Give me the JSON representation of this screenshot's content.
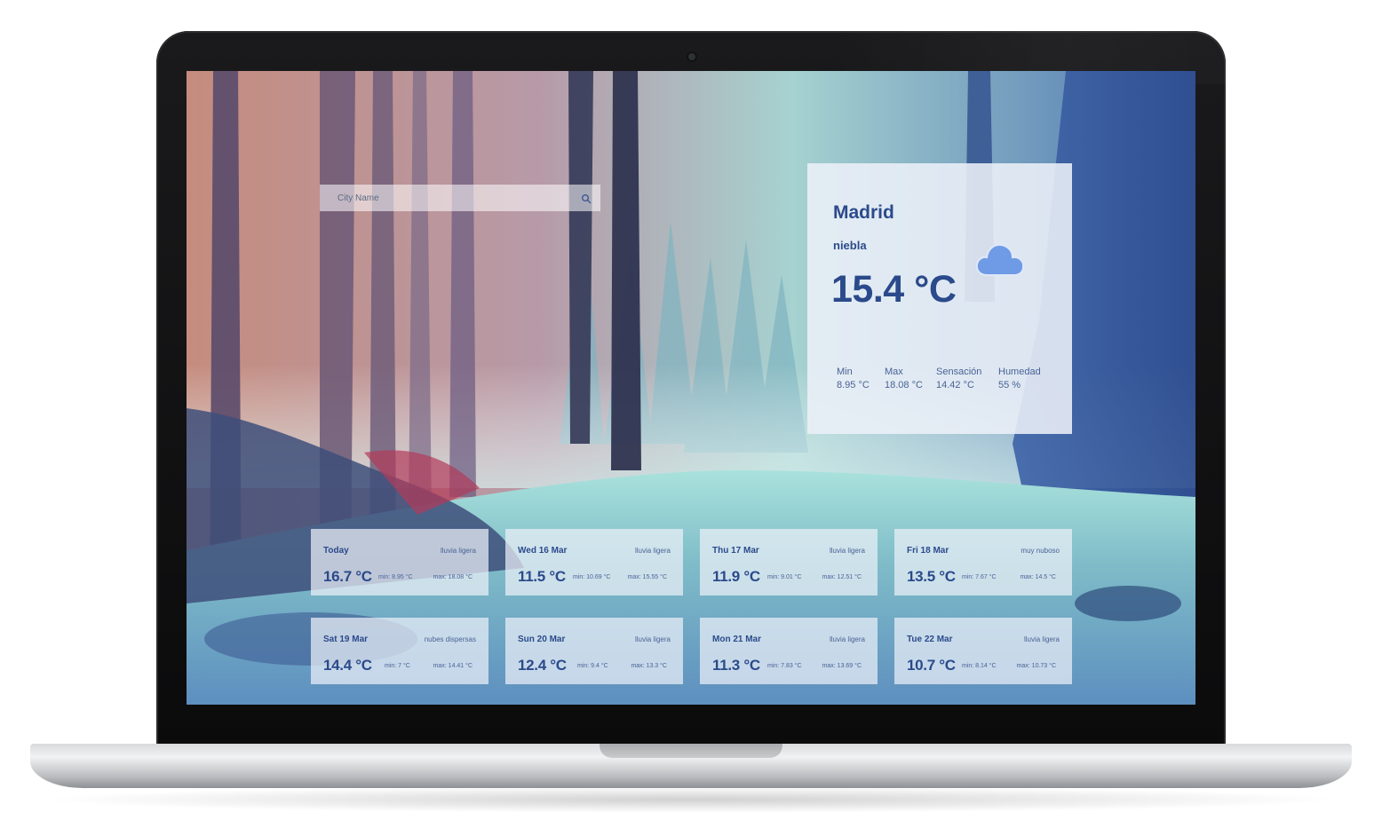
{
  "search": {
    "placeholder": "City Name"
  },
  "current": {
    "city": "Madrid",
    "description": "niebla",
    "temperature": "15.4 °C",
    "icon": "cloud-icon",
    "stats": {
      "min_label": "Min",
      "min_value": "8.95 °C",
      "max_label": "Max",
      "max_value": "18.08 °C",
      "feels_label": "Sensación",
      "feels_value": "14.42 °C",
      "humidity_label": "Humedad",
      "humidity_value": "55 %"
    }
  },
  "forecast": [
    {
      "day": "Today",
      "desc": "lluvia ligera",
      "temp": "16.7 °C",
      "min": "min: 8.95 °C",
      "max": "max: 18.08 °C"
    },
    {
      "day": "Wed 16 Mar",
      "desc": "lluvia ligera",
      "temp": "11.5 °C",
      "min": "min: 10.69 °C",
      "max": "max: 15.55 °C"
    },
    {
      "day": "Thu 17 Mar",
      "desc": "lluvia ligera",
      "temp": "11.9 °C",
      "min": "min: 9.01 °C",
      "max": "max: 12.51 °C"
    },
    {
      "day": "Fri 18 Mar",
      "desc": "muy nuboso",
      "temp": "13.5 °C",
      "min": "min: 7.67 °C",
      "max": "max: 14.5 °C"
    },
    {
      "day": "Sat 19 Mar",
      "desc": "nubes dispersas",
      "temp": "14.4 °C",
      "min": "min: 7 °C",
      "max": "max: 14.41 °C"
    },
    {
      "day": "Sun 20 Mar",
      "desc": "lluvia ligera",
      "temp": "12.4 °C",
      "min": "min: 9.4 °C",
      "max": "max: 13.3 °C"
    },
    {
      "day": "Mon 21 Mar",
      "desc": "lluvia ligera",
      "temp": "11.3 °C",
      "min": "min: 7.83 °C",
      "max": "max: 13.69 °C"
    },
    {
      "day": "Tue 22 Mar",
      "desc": "lluvia ligera",
      "temp": "10.7 °C",
      "min": "min: 8.14 °C",
      "max": "max: 10.73 °C"
    }
  ],
  "colors": {
    "accent": "#2b4a8b",
    "secondary_text": "#4a6296",
    "cloud": "#6f9be6"
  }
}
